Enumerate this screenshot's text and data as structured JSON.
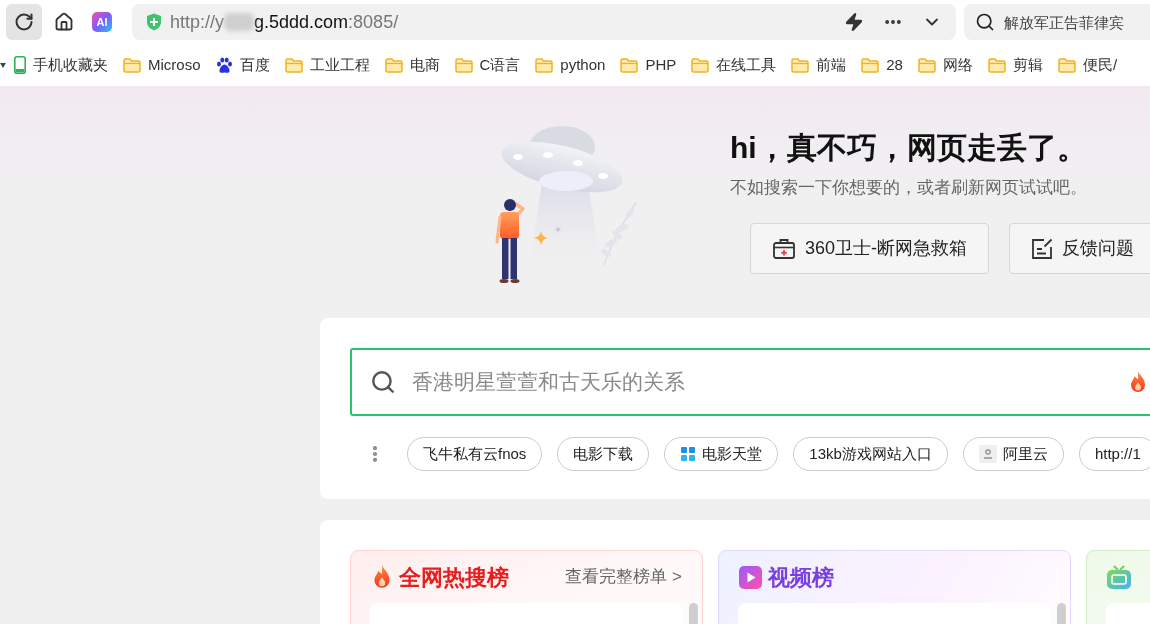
{
  "toolbar": {
    "buttons": [
      {
        "kind": "reload",
        "hovered": true
      },
      {
        "kind": "home",
        "hovered": false
      },
      {
        "kind": "ai",
        "label": "AI",
        "hovered": false
      }
    ]
  },
  "address_bar": {
    "url_start": "http://y",
    "redacted": true,
    "url_host": "g.5ddd.com",
    "url_rest": ":8085/"
  },
  "search_field": {
    "placeholder": "解放军正告菲律宾"
  },
  "bookmarks": [
    {
      "kind": "phone",
      "label": "手机收藏夹"
    },
    {
      "kind": "folder",
      "label": "Microso"
    },
    {
      "kind": "paw",
      "label": "百度"
    },
    {
      "kind": "folder",
      "label": "工业工程"
    },
    {
      "kind": "folder",
      "label": "电商"
    },
    {
      "kind": "folder",
      "label": "C语言"
    },
    {
      "kind": "folder",
      "label": "python"
    },
    {
      "kind": "folder",
      "label": "PHP"
    },
    {
      "kind": "folder",
      "label": "在线工具"
    },
    {
      "kind": "folder",
      "label": "前端"
    },
    {
      "kind": "folder",
      "label": "28"
    },
    {
      "kind": "folder",
      "label": "网络"
    },
    {
      "kind": "folder",
      "label": "剪辑"
    },
    {
      "kind": "folder",
      "label": "便民/"
    }
  ],
  "error": {
    "title": "hi，真不巧，网页走丢了。",
    "subtitle": "不如搜索一下你想要的，或者刷新网页试试吧。",
    "buttons": [
      {
        "kind": "rescue",
        "label": "360卫士-断网急救箱"
      },
      {
        "kind": "feedback",
        "label": "反馈问题"
      }
    ]
  },
  "web_search": {
    "placeholder": "香港明星萱萱和古天乐的关系",
    "quick_links": [
      {
        "kind": "text",
        "label": "飞牛私有云fnos"
      },
      {
        "kind": "text",
        "label": "电影下载"
      },
      {
        "kind": "logo",
        "label": "电影天堂"
      },
      {
        "kind": "text",
        "label": "13kb游戏网站入口"
      },
      {
        "kind": "favicon",
        "label": "阿里云"
      },
      {
        "kind": "text",
        "label": "http://1"
      }
    ]
  },
  "rankings": [
    {
      "kind": "hot",
      "title": "全网热搜榜",
      "link": "查看完整榜单 >"
    },
    {
      "kind": "video",
      "title": "视频榜"
    },
    {
      "kind": "tv"
    }
  ]
}
